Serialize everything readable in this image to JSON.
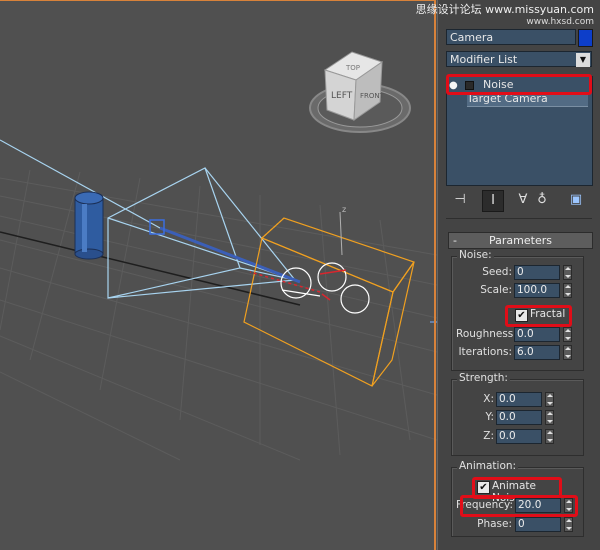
{
  "watermark": {
    "line1": "思缘设计论坛",
    "line2": "www.missyuan.com",
    "line3": "www.hxsd.com"
  },
  "viewcube": {
    "left": "LEFT",
    "front": "FRONT",
    "top": "TOP"
  },
  "panel": {
    "object_name": "Camera",
    "object_color": "#0d3ec9",
    "modifier_list": "Modifier List",
    "stack": [
      {
        "label": "Noise",
        "highlighted": true
      },
      {
        "label": "Target Camera",
        "highlighted": false
      }
    ],
    "toolbar": [
      "pin-stack-icon",
      "show-end-result-icon",
      "make-unique-icon",
      "remove-modifier-icon",
      "configure-sets-icon"
    ],
    "rollout": {
      "collapse_sign": "-",
      "title": "Parameters"
    },
    "noise_group": {
      "label": "Noise:",
      "seed": {
        "label": "Seed:",
        "value": "0"
      },
      "scale": {
        "label": "Scale:",
        "value": "100.0"
      },
      "fractal": {
        "label": "Fractal",
        "checked": true
      },
      "roughness": {
        "label": "Roughness:",
        "value": "0.0"
      },
      "iterations": {
        "label": "Iterations:",
        "value": "6.0"
      }
    },
    "strength_group": {
      "label": "Strength:",
      "x": {
        "label": "X:",
        "value": "0.0"
      },
      "y": {
        "label": "Y:",
        "value": "0.0"
      },
      "z": {
        "label": "Z:",
        "value": "0.0"
      }
    },
    "animation_group": {
      "label": "Animation:",
      "animate_noise": {
        "label": "Animate Noise",
        "checked": true
      },
      "frequency": {
        "label": "Frequency:",
        "value": "20.0"
      },
      "phase": {
        "label": "Phase:",
        "value": "0"
      }
    },
    "check_glyph": "✔"
  },
  "colors": {
    "highlight": "#e10d18",
    "selection": "#f0a020",
    "camera_wire": "#a8d4f0"
  }
}
